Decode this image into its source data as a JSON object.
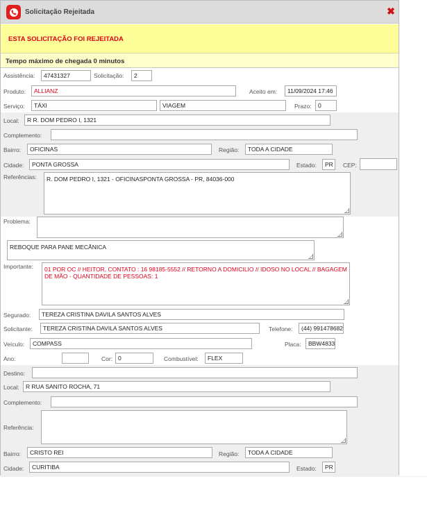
{
  "window": {
    "title": "Solicitação Rejeitada",
    "icon": "phone-icon",
    "close_glyph": "✖"
  },
  "banner": {
    "message": "ESTA SOLICITAÇÃO FOI REJEITADA",
    "sub": "Tempo máximo de chegada 0 minutos"
  },
  "colors": {
    "banner_bg": "#ffff99",
    "alert_text": "#e0001a",
    "close": "#d01010"
  },
  "labels": {
    "assistencia": "Assistência:",
    "solicitacao": "Solicitação:",
    "produto": "Produto:",
    "aceito_em": "Aceito em:",
    "servico": "Serviço:",
    "prazo": "Prazo:",
    "local": "Local:",
    "complemento": "Complemento:",
    "bairro": "Bairro:",
    "regiao": "Região:",
    "cidade": "Cidade:",
    "estado": "Estado:",
    "cep": "CEP:",
    "referencias": "Referências:",
    "problema": "Problema:",
    "importante": "Importante:",
    "segurado": "Segurado:",
    "solicitante": "Solicitante:",
    "telefone": "Telefone:",
    "veiculo": "Veículo:",
    "placa": "Placa:",
    "ano": "Ano:",
    "cor": "Cor:",
    "combustivel": "Combustível:",
    "destino": "Destino:",
    "local2": "Local:",
    "complemento2": "Complemento:",
    "referencia": "Referência:",
    "bairro2": "Bairro:",
    "regiao2": "Região:",
    "cidade2": "Cidade:",
    "estado2": "Estado:"
  },
  "values": {
    "assistencia": "47431327",
    "solicitacao": "2",
    "produto": "ALLIANZ",
    "aceito_em": "11/09/2024 17:46",
    "servico": "TÁXI",
    "servico_tipo": "VIAGEM",
    "prazo": "0",
    "local": "R R. DOM PEDRO I, 1321",
    "complemento": "",
    "bairro": "OFICINAS",
    "regiao": "TODA A CIDADE",
    "cidade": "PONTA GROSSA",
    "estado": "PR",
    "cep": "",
    "referencias": "R. DOM PEDRO I, 1321 - OFICINASPONTA GROSSA - PR, 84036-000",
    "problema": "",
    "problema_desc": "REBOQUE PARA PANE MECÂNICA",
    "importante": "01 POR OC //  HEITOR, CONTATO : 16 98185-5552 // RETORNO A DOMICILIO // IDOSO NO LOCAL // BAGAGEM DE MÃO - QUANTIDADE DE PESSOAS:  1",
    "segurado": "TEREZA CRISTINA DAVILA SANTOS ALVES",
    "solicitante": "TEREZA CRISTINA DAVILA SANTOS ALVES",
    "telefone": "(44) 991478682",
    "veiculo": "COMPASS",
    "placa": "BBW4833",
    "ano": "",
    "cor": "0",
    "combustivel": "FLEX",
    "destino": "",
    "local2": "R RUA SANITO ROCHA, 71",
    "complemento2": "",
    "referencia": "",
    "bairro2": "CRISTO REI",
    "regiao2": "TODA A CIDADE",
    "cidade2": "CURITIBA",
    "estado2": "PR"
  }
}
